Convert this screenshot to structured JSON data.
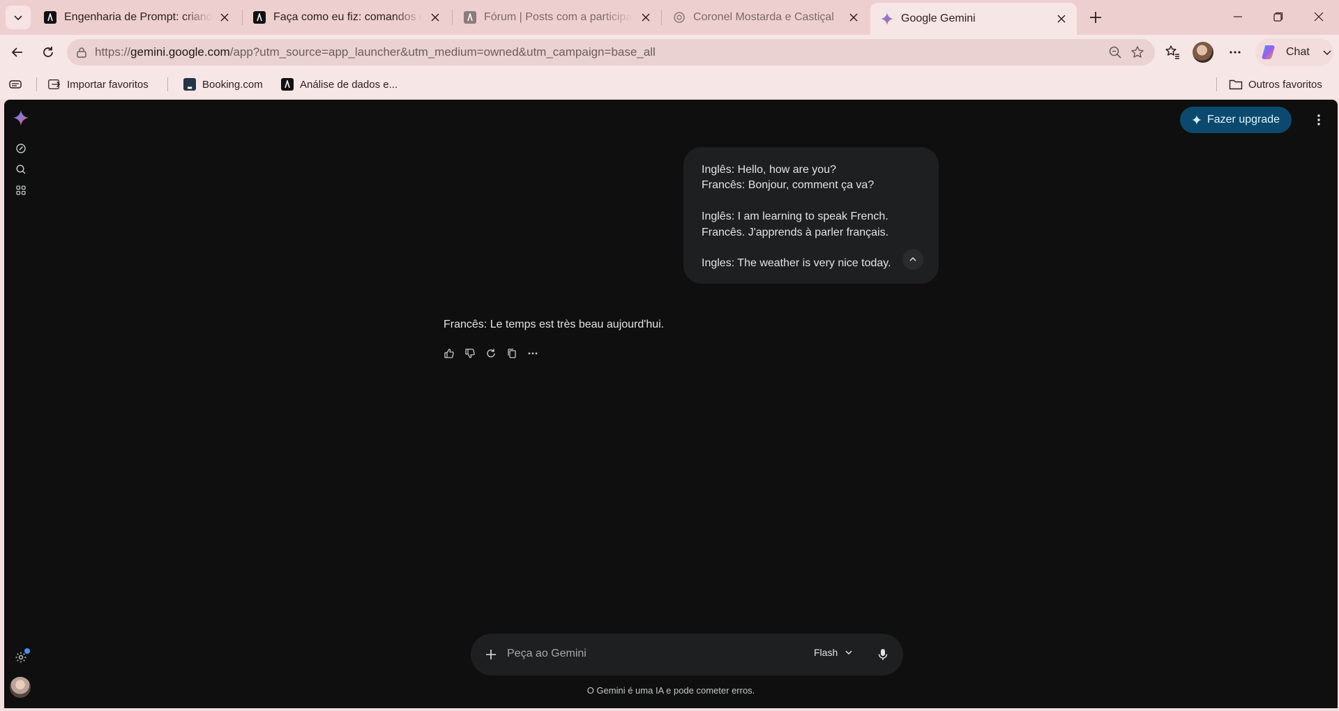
{
  "browser": {
    "tabs": [
      {
        "title": "Engenharia de Prompt: criando pro",
        "icon": "anthropic-icon"
      },
      {
        "title": "Faça como eu fiz: comandos com e",
        "icon": "anthropic-icon"
      },
      {
        "title": "Fórum | Posts com a participação d",
        "icon": "anthropic-icon"
      },
      {
        "title": "Coronel Mostarda e Castiçal",
        "icon": "chatgpt-icon"
      },
      {
        "title": "Google Gemini",
        "icon": "gemini-icon"
      }
    ],
    "url": {
      "scheme": "https://",
      "host": "gemini.google.com",
      "path": "/app?utm_source=app_launcher&utm_medium=owned&utm_campaign=base_all"
    },
    "chat_button_label": "Chat",
    "bookmarks": [
      {
        "label": "Importar favoritos"
      },
      {
        "label": "Booking.com"
      },
      {
        "label": "Análise de dados e..."
      }
    ],
    "other_bookmarks_label": "Outros favoritos"
  },
  "gemini": {
    "upgrade_label": "Fazer upgrade",
    "user_message_lines": [
      "Inglês: Hello, how are you?",
      "Francês: Bonjour, comment ça va?",
      "",
      "Inglês: I am learning to speak French.",
      "Francês. J'apprends à parler français.",
      "",
      "Ingles: The weather is very nice today."
    ],
    "response_text": "Francês: Le temps est très beau aujourd'hui.",
    "composer": {
      "placeholder": "Peça ao Gemini",
      "model_label": "Flash"
    },
    "disclaimer": "O Gemini é uma IA e pode cometer erros."
  }
}
